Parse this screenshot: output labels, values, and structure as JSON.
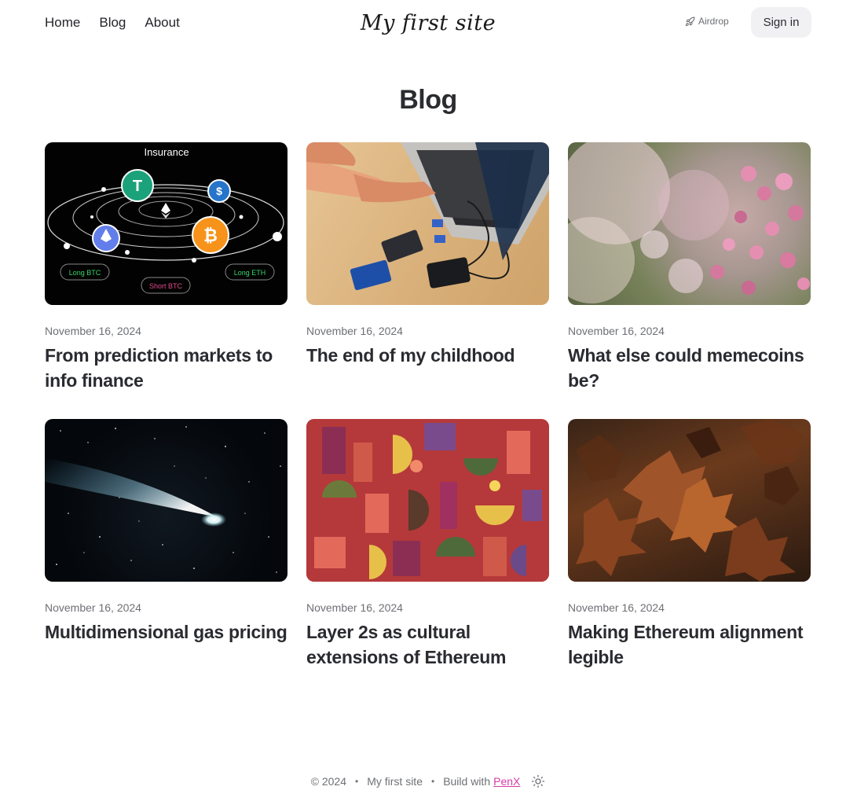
{
  "nav": {
    "items": [
      {
        "label": "Home"
      },
      {
        "label": "Blog"
      },
      {
        "label": "About"
      }
    ]
  },
  "site": {
    "name": "My first site"
  },
  "header": {
    "airdrop_label": "Airdrop",
    "airdrop_icon": "rocket-icon",
    "signin_label": "Sign in"
  },
  "page": {
    "title": "Blog"
  },
  "posts": [
    {
      "date": "November 16, 2024",
      "title": "From prediction markets to info finance",
      "image": "crypto-insurance-diagram",
      "image_text": {
        "top": "Insurance",
        "left": "Long BTC",
        "right": "Long ETH",
        "bottom": "Short BTC"
      }
    },
    {
      "date": "November 16, 2024",
      "title": "The end of my childhood",
      "image": "laptop-with-drives"
    },
    {
      "date": "November 16, 2024",
      "title": "What else could memecoins be?",
      "image": "pink-flowers"
    },
    {
      "date": "November 16, 2024",
      "title": "Multidimensional gas pricing",
      "image": "comet-in-space"
    },
    {
      "date": "November 16, 2024",
      "title": "Layer 2s as cultural extensions of Ethereum",
      "image": "abstract-pattern"
    },
    {
      "date": "November 16, 2024",
      "title": "Making Ethereum alignment legible",
      "image": "autumn-leaves"
    }
  ],
  "footer": {
    "copyright": "© 2024",
    "separator": "•",
    "site_name": "My first site",
    "build_with": "Build with",
    "brand": "PenX",
    "theme_icon": "sun-icon"
  },
  "colors": {
    "brand_accent": "#d63aa5",
    "text": "#2a2b30",
    "muted": "#6e7075",
    "button_bg": "#f1f1f3"
  }
}
